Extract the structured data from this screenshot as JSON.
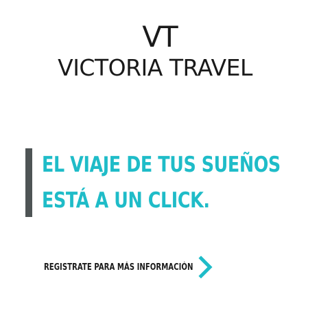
{
  "brand": {
    "logo_mark": "VT",
    "name": "VICTORIA TRAVEL"
  },
  "headline": {
    "line1": "EL VIAJE DE TUS SUEÑOS",
    "line2": "ESTÁ A UN CLICK."
  },
  "cta": {
    "label": "REGISTRATE PARA MÁS INFORMACIÓN",
    "icon": "chevron-right-icon"
  },
  "colors": {
    "accent": "#1fbcc8",
    "bar": "#4e5455",
    "text": "#1a1a1a",
    "background": "#ffffff"
  }
}
